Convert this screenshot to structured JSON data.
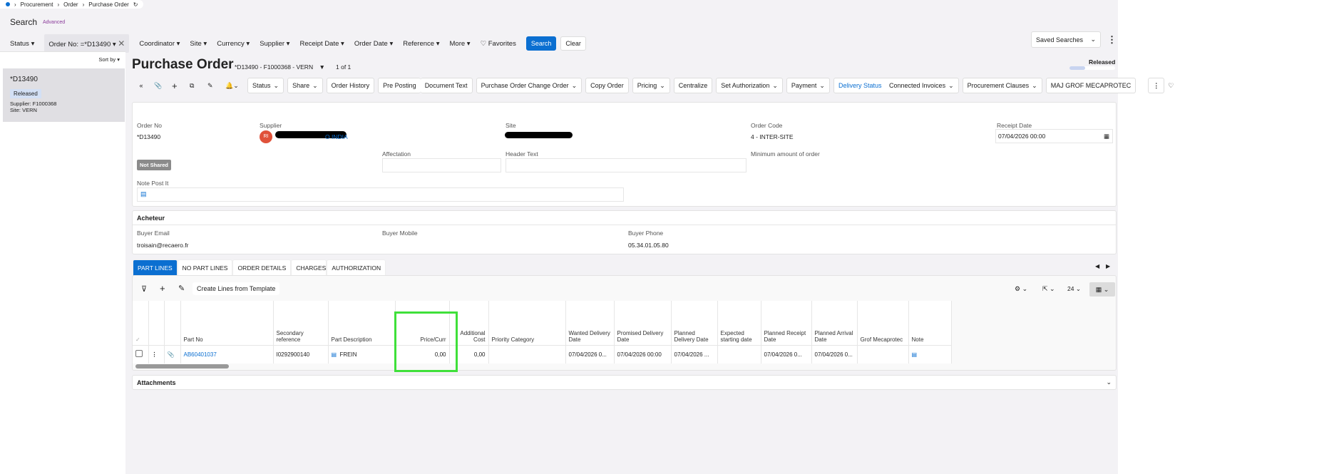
{
  "breadcrumb": [
    "Procurement",
    "Order",
    "Purchase Order"
  ],
  "search": {
    "title": "Search",
    "advanced": "Advanced",
    "filters": [
      "Status",
      "Order No: =*D13490",
      "Coordinator",
      "Site",
      "Currency",
      "Supplier",
      "Receipt Date",
      "Order Date",
      "Reference",
      "More"
    ],
    "favorites": "Favorites",
    "search_btn": "Search",
    "clear_btn": "Clear",
    "saved_searches": "Saved Searches"
  },
  "list": {
    "sort_by": "Sort by",
    "item": {
      "id": "*D13490",
      "status": "Released",
      "supplier": "Supplier:  F1000368",
      "site": "Site:  VERN"
    }
  },
  "header": {
    "title": "Purchase Order",
    "record": "*D13490 - F1000368 - VERN",
    "count": "1 of 1",
    "status": "Released"
  },
  "toolbar": [
    "Status",
    "Share",
    "Order History",
    "Pre Posting",
    "Document Text",
    "Purchase Order Change Order",
    "Copy Order",
    "Pricing",
    "Centralize",
    "Set Authorization",
    "Payment",
    "Delivery Status",
    "Connected Invoices",
    "Procurement Clauses",
    "MAJ GROF MECAPROTEC"
  ],
  "form": {
    "order_no_label": "Order No",
    "order_no": "*D13490",
    "supplier_label": "Supplier",
    "supplier_initials": "RI",
    "supplier_name": "O INDIA",
    "site_label": "Site",
    "order_code_label": "Order Code",
    "order_code": "4 - INTER-SITE",
    "receipt_date_label": "Receipt Date",
    "receipt_date": "07/04/2026 00:00",
    "not_shared": "Not Shared",
    "affectation_label": "Affectation",
    "header_text_label": "Header Text",
    "min_amount_label": "Minimum amount of order",
    "note_label": "Note Post It"
  },
  "buyer": {
    "title": "Acheteur",
    "email_label": "Buyer Email",
    "email": "troisain@recaero.fr",
    "mobile_label": "Buyer Mobile",
    "phone_label": "Buyer Phone",
    "phone": "05.34.01.05.80"
  },
  "tabs": [
    "PART LINES",
    "NO PART LINES",
    "ORDER DETAILS",
    "CHARGES",
    "AUTHORIZATION"
  ],
  "grid": {
    "create_template": "Create Lines from Template",
    "page_size": "24",
    "columns": [
      "Part No",
      "Secondary reference",
      "Part Description",
      "Price/Curr",
      "Additional Cost",
      "Priority Category",
      "Wanted Delivery Date",
      "Promised Delivery Date",
      "Planned Delivery Date",
      "Expected starting date",
      "Planned Receipt Date",
      "Planned Arrival Date",
      "Grof Mecaprotec",
      "Note"
    ],
    "row": {
      "part_no": "AB60401037",
      "secondary": "I0292900140",
      "description": "FREIN",
      "price": "0,00",
      "additional": "0,00",
      "priority": "",
      "wanted": "07/04/2026 0...",
      "promised": "07/04/2026 00:00",
      "planned": "07/04/2026 ...",
      "expected": "",
      "planned_receipt": "07/04/2026 0...",
      "planned_arrival": "07/04/2026 0...",
      "grof": ""
    }
  },
  "attachments": "Attachments"
}
